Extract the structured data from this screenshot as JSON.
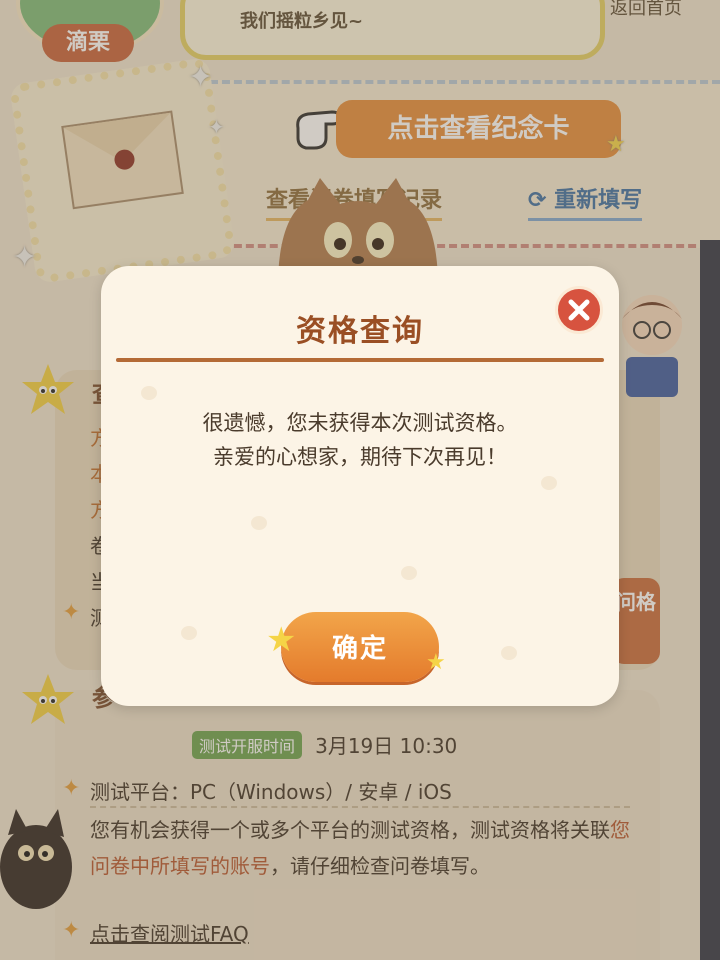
{
  "header": {
    "avatar_name": "滴栗",
    "bubble_text": "我们摇粒乡见~",
    "home_link": "返回首页"
  },
  "letter": {
    "view_card_button": "点击查看纪念卡",
    "view_record_link": "查看问卷填写记录",
    "refill_link": "重新填写"
  },
  "section1": {
    "title_initial": "查",
    "lines": [
      "方",
      "本",
      "方",
      "卷",
      "当",
      "测"
    ],
    "side_button": "问格"
  },
  "section2": {
    "title_initial": "参",
    "open_time_badge": "测试开服时间",
    "open_time_value": "3月19日 10:30",
    "platform": "测试平台：PC（Windows）/ 安卓 / iOS",
    "para_part1": "您有机会获得一个或多个平台的测试资格，测试资格将关联",
    "para_highlight": "您问卷中所填写的账号",
    "para_part2": "，请仔细检查问卷填写。",
    "faq_link": "点击查阅测试FAQ"
  },
  "modal": {
    "title": "资格查询",
    "message_line1": "很遗憾，您未获得本次测试资格。",
    "message_line2": "亲爱的心想家，期待下次再见！",
    "confirm_label": "确定"
  },
  "colors": {
    "accent_orange": "#e58d3a",
    "title_brown": "#9a4f24",
    "close_red": "#d7533f"
  }
}
